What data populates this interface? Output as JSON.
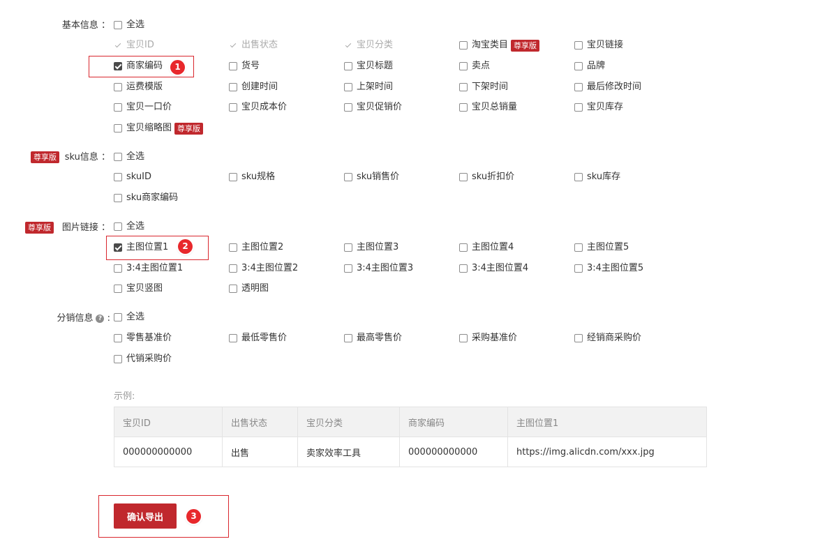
{
  "basic": {
    "label": "基本信息 ：",
    "select_all": "全选",
    "items": [
      {
        "text": "宝贝ID",
        "state": "disabled"
      },
      {
        "text": "出售状态",
        "state": "disabled"
      },
      {
        "text": "宝贝分类",
        "state": "disabled"
      },
      {
        "text": "淘宝类目",
        "state": "unchecked",
        "badge": "尊享版"
      },
      {
        "text": "宝贝链接",
        "state": "unchecked"
      },
      {
        "text": "商家编码",
        "state": "checked"
      },
      {
        "text": "货号",
        "state": "unchecked"
      },
      {
        "text": "宝贝标题",
        "state": "unchecked"
      },
      {
        "text": "卖点",
        "state": "unchecked"
      },
      {
        "text": "品牌",
        "state": "unchecked"
      },
      {
        "text": "运费模版",
        "state": "unchecked"
      },
      {
        "text": "创建时间",
        "state": "unchecked"
      },
      {
        "text": "上架时间",
        "state": "unchecked"
      },
      {
        "text": "下架时间",
        "state": "unchecked"
      },
      {
        "text": "最后修改时间",
        "state": "unchecked"
      },
      {
        "text": "宝贝一口价",
        "state": "unchecked"
      },
      {
        "text": "宝贝成本价",
        "state": "unchecked"
      },
      {
        "text": "宝贝促销价",
        "state": "unchecked"
      },
      {
        "text": "宝贝总销量",
        "state": "unchecked"
      },
      {
        "text": "宝贝库存",
        "state": "unchecked"
      },
      {
        "text": "宝贝缩略图",
        "state": "unchecked",
        "badge": "尊享版"
      }
    ]
  },
  "sku": {
    "badge": "尊享版",
    "label": "sku信息 ：",
    "select_all": "全选",
    "items": [
      {
        "text": "skuID",
        "state": "unchecked"
      },
      {
        "text": "sku规格",
        "state": "unchecked"
      },
      {
        "text": "sku销售价",
        "state": "unchecked"
      },
      {
        "text": "sku折扣价",
        "state": "unchecked"
      },
      {
        "text": "sku库存",
        "state": "unchecked"
      },
      {
        "text": "sku商家编码",
        "state": "unchecked"
      }
    ]
  },
  "image": {
    "badge": "尊享版",
    "label": "图片链接 ：",
    "select_all": "全选",
    "items": [
      {
        "text": "主图位置1",
        "state": "checked"
      },
      {
        "text": "主图位置2",
        "state": "unchecked"
      },
      {
        "text": "主图位置3",
        "state": "unchecked"
      },
      {
        "text": "主图位置4",
        "state": "unchecked"
      },
      {
        "text": "主图位置5",
        "state": "unchecked"
      },
      {
        "text": "3:4主图位置1",
        "state": "unchecked"
      },
      {
        "text": "3:4主图位置2",
        "state": "unchecked"
      },
      {
        "text": "3:4主图位置3",
        "state": "unchecked"
      },
      {
        "text": "3:4主图位置4",
        "state": "unchecked"
      },
      {
        "text": "3:4主图位置5",
        "state": "unchecked"
      },
      {
        "text": "宝贝竖图",
        "state": "unchecked"
      },
      {
        "text": "透明图",
        "state": "unchecked"
      }
    ]
  },
  "distribution": {
    "label": "分销信息",
    "colon": ":",
    "select_all": "全选",
    "items": [
      {
        "text": "零售基准价",
        "state": "unchecked"
      },
      {
        "text": "最低零售价",
        "state": "unchecked"
      },
      {
        "text": "最高零售价",
        "state": "unchecked"
      },
      {
        "text": "采购基准价",
        "state": "unchecked"
      },
      {
        "text": "经销商采购价",
        "state": "unchecked"
      },
      {
        "text": "代销采购价",
        "state": "unchecked"
      }
    ]
  },
  "example": {
    "label": "示例:",
    "headers": [
      "宝贝ID",
      "出售状态",
      "宝贝分类",
      "商家编码",
      "主图位置1"
    ],
    "row": [
      "000000000000",
      "出售",
      "卖家效率工具",
      "000000000000",
      "https://img.alicdn.com/xxx.jpg"
    ]
  },
  "confirm_button": "确认导出",
  "markers": [
    "1",
    "2",
    "3"
  ],
  "colors": {
    "brand_red": "#c0282d",
    "marker_red": "#e8282c",
    "checkbox_dark": "#4a4a4a"
  }
}
